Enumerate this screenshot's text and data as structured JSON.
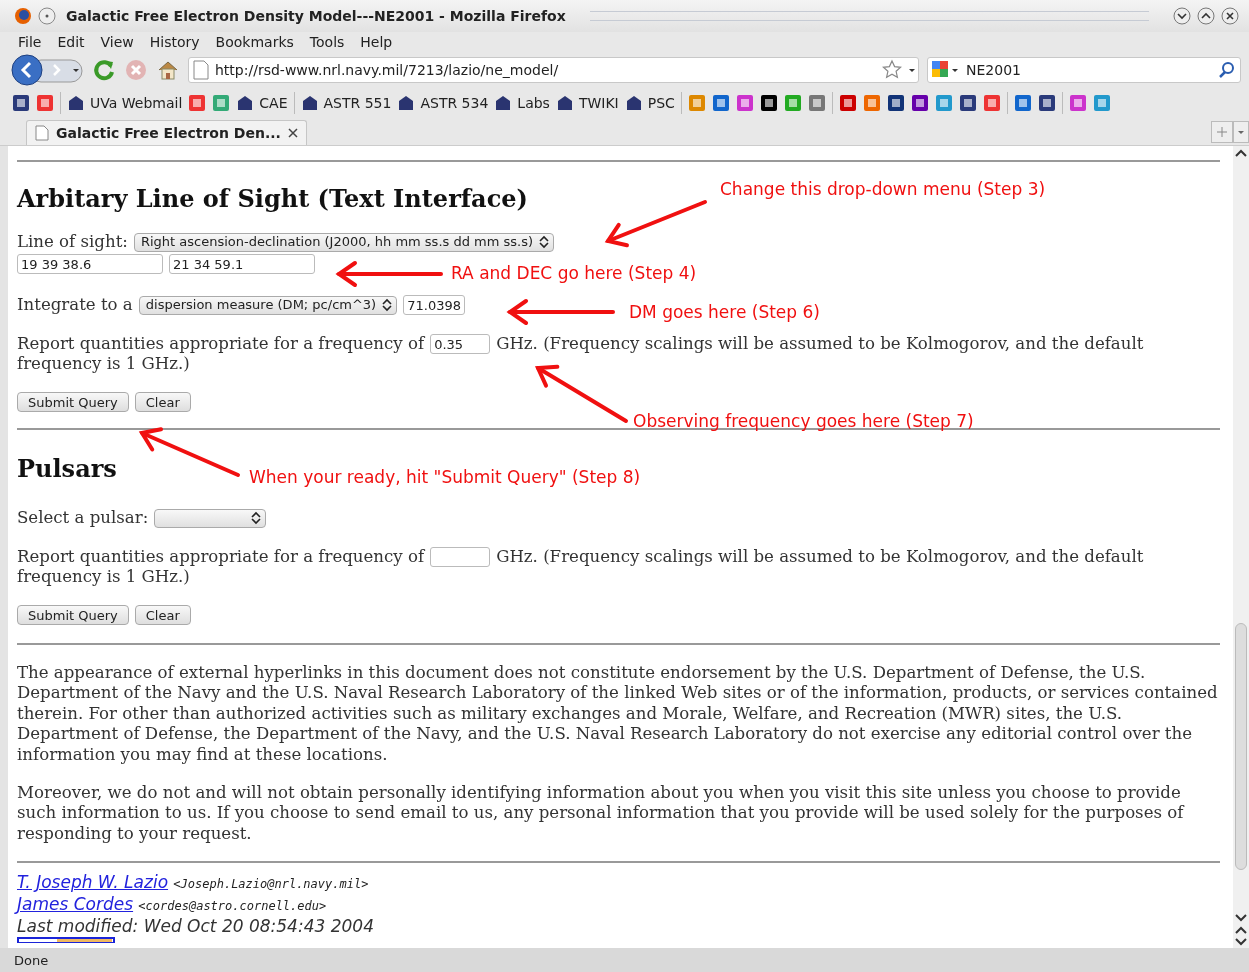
{
  "window": {
    "title": "Galactic Free Electron Density Model---NE2001 - Mozilla Firefox"
  },
  "menu": [
    "File",
    "Edit",
    "View",
    "History",
    "Bookmarks",
    "Tools",
    "Help"
  ],
  "address": {
    "value": "http://rsd-www.nrl.navy.mil/7213/lazio/ne_model/"
  },
  "search": {
    "value": "NE2001"
  },
  "bookmarks": [
    {
      "label": "UVa Webmail"
    },
    {
      "label": "CAE"
    },
    {
      "label": "ASTR 551"
    },
    {
      "label": "ASTR 534"
    },
    {
      "label": "Labs"
    },
    {
      "label": "TWIKI"
    },
    {
      "label": "PSC"
    }
  ],
  "tabs": [
    {
      "label": "Galactic Free Electron Den...",
      "selected": true
    }
  ],
  "los": {
    "heading": "Arbitary Line of Sight (Text Interface)",
    "label": "Line of sight:",
    "select": "Right ascension-declination (J2000, hh mm ss.s dd mm ss.s)",
    "ra": "19 39 38.6",
    "dec": "21 34 59.1",
    "integrate_label": "Integrate to a",
    "integrate_select": "dispersion measure (DM; pc/cm^3)",
    "integrate_value": "71.0398",
    "freq_before": "Report quantities appropriate for a frequency of",
    "freq_value": "0.35",
    "freq_after": [
      "GHz. (Frequency scalings will be assumed to be Kolmogorov, and the default",
      "frequency is 1 GHz.)"
    ],
    "buttons": [
      "Submit Query",
      "Clear"
    ]
  },
  "pulsars": {
    "heading": "Pulsars",
    "label": "Select a pulsar:",
    "freq_before": "Report quantities appropriate for a frequency of",
    "freq_after": [
      "GHz. (Frequency scalings will be assumed to be Kolmogorov, and the default",
      "frequency is 1 GHz.)"
    ],
    "buttons": [
      "Submit Query",
      "Clear"
    ]
  },
  "disclaimer": [
    "The appearance of external hyperlinks in this document does not constitute endorsement by the U.S. Department of Defense, the U.S. Department of the Navy and the U.S. Naval Research Laboratory of the linked Web sites or of the information, products, or services contained therein. For other than authorized activities such as military exchanges and Morale, Welfare, and Recreation (MWR) sites, the U.S. Department of Defense, the Department of the Navy, and the U.S. Naval Research Laboratory do not exercise any editorial control over the information you may find at these locations.",
    "Moreover, we do not and will not obtain personally identifying information about you when you visit this site unless you choose to provide such information to us. If you choose to send email to us, any personal information that you provide will be used solely for the purposes of responding to your request."
  ],
  "authors": [
    {
      "name": "T. Joseph W. Lazio",
      "email": "<Joseph.Lazio@nrl.navy.mil>"
    },
    {
      "name": "James Cordes",
      "email": "<cordes@astro.cornell.edu>"
    }
  ],
  "last_modified": "Last modified: Wed Oct 20 08:54:43 2004",
  "annotations": [
    "Change this drop-down menu (Step 3)",
    "RA and DEC go here (Step 4)",
    "DM goes here (Step 6)",
    "Observing frequency goes here (Step 7)",
    "When your ready, hit \"Submit Query\" (Step 8)"
  ],
  "status_bar": "Done"
}
